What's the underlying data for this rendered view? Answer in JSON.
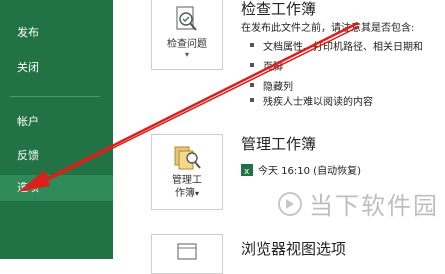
{
  "sidebar": {
    "items": [
      {
        "label": "发布"
      },
      {
        "label": "关闭"
      },
      {
        "label": "帐户"
      },
      {
        "label": "反馈"
      },
      {
        "label": "选项"
      }
    ]
  },
  "inspect": {
    "button_label": "检查问题",
    "title": "检查工作簿",
    "desc": "在发布此文件之前，请注意其是否包含:",
    "bullets": [
      "文档属性、打印机路径、相关日期和",
      "页脚",
      "隐藏列",
      "残疾人士难以阅读的内容"
    ]
  },
  "manage": {
    "button_label_1": "管理工",
    "button_label_2": "作簿",
    "title": "管理工作簿",
    "version": "今天 16:10 (自动恢复)"
  },
  "browser": {
    "title": "浏览器视图选项"
  },
  "watermark": {
    "text": "当下软件园"
  }
}
